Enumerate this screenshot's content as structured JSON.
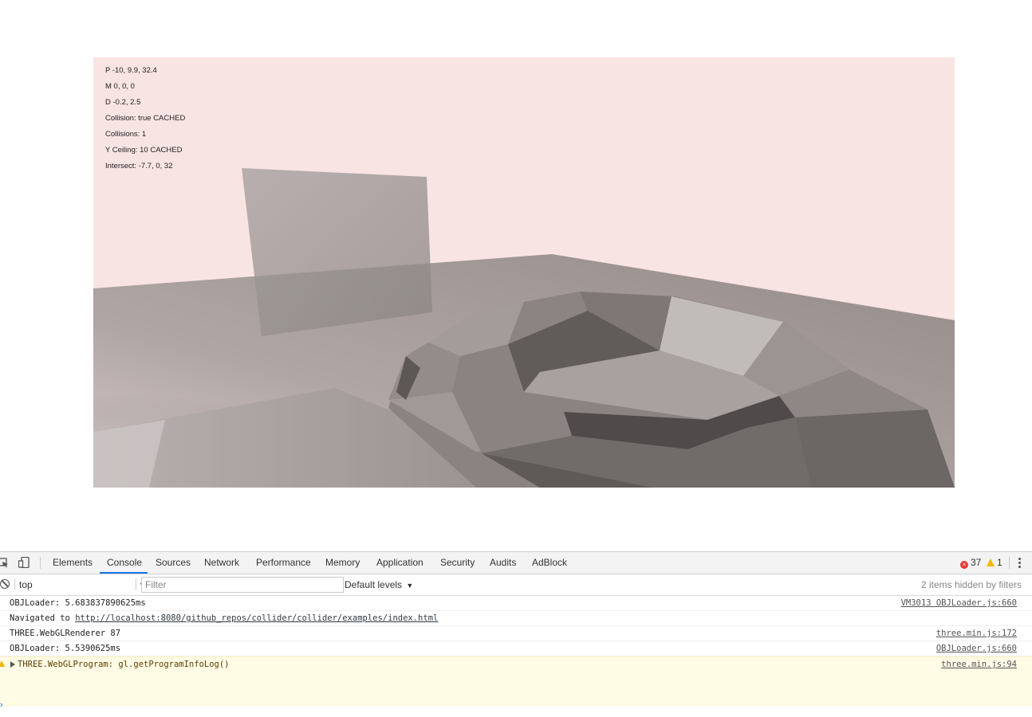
{
  "hud": {
    "lines": [
      "P -10, 9.9, 32.4",
      "M 0, 0, 0",
      "D -0.2, 2.5",
      "Collision: true CACHED",
      "Collisions: 1",
      "Y Ceiling: 10 CACHED",
      "Intersect: -7.7, 0, 32"
    ]
  },
  "colors": {
    "sky": "#f8e4e2",
    "floor": "#a8a09e",
    "accent": "#1a73e8",
    "error": "#e53935",
    "warning": "#f2b600"
  },
  "devtools": {
    "icons": [
      "inspect-icon",
      "device-toolbar-icon"
    ],
    "tabs": [
      "Elements",
      "Console",
      "Sources",
      "Network",
      "Performance",
      "Memory",
      "Application",
      "Security",
      "Audits",
      "AdBlock"
    ],
    "active_tab": "Console",
    "error_count": "37",
    "warning_count": "1",
    "context": "top",
    "filter_placeholder": "Filter",
    "levels": "Default levels",
    "hidden_info": "2 items hidden by filters"
  },
  "console": {
    "rows": [
      {
        "message": "OBJLoader: 5.683837890625ms",
        "source": "VM3013 OBJLoader.js:660"
      },
      {
        "prefix": "Navigated to ",
        "link": "http://localhost:8080/github_repos/collider/collider/examples/index.html",
        "source": ""
      },
      {
        "message": "THREE.WebGLRenderer 87",
        "source": "three.min.js:172"
      },
      {
        "message": "OBJLoader: 5.5390625ms",
        "source": "OBJLoader.js:660"
      },
      {
        "message": "THREE.WebGLProgram: gl.getProgramInfoLog()",
        "source": "three.min.js:94",
        "level": "warning"
      }
    ]
  }
}
